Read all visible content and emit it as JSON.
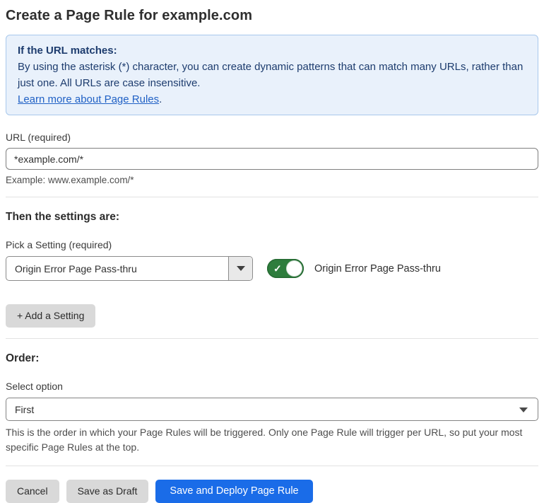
{
  "page": {
    "title": "Create a Page Rule for example.com"
  },
  "info_box": {
    "heading": "If the URL matches:",
    "body": "By using the asterisk (*) character, you can create dynamic patterns that can match many URLs, rather than just one. All URLs are case insensitive.",
    "link_label": "Learn more about Page Rules",
    "link_suffix": "."
  },
  "url_field": {
    "label": "URL (required)",
    "value": "*example.com/*",
    "example": "Example: www.example.com/*"
  },
  "settings_section": {
    "heading": "Then the settings are:",
    "picker_label": "Pick a Setting (required)",
    "selected_setting": "Origin Error Page Pass-thru",
    "toggle_label": "Origin Error Page Pass-thru",
    "toggle_state": "on",
    "toggle_check_glyph": "✓",
    "add_setting_label": "+ Add a Setting"
  },
  "order_section": {
    "heading": "Order:",
    "select_label": "Select option",
    "selected_option": "First",
    "help_text": "This is the order in which your Page Rules will be triggered. Only one Page Rule will trigger per URL, so put your most specific Page Rules at the top."
  },
  "footer": {
    "cancel_label": "Cancel",
    "save_draft_label": "Save as Draft",
    "save_deploy_label": "Save and Deploy Page Rule"
  },
  "colors": {
    "accent_blue": "#1a6ce8",
    "toggle_green": "#2e7d3d",
    "info_box_bg": "#e9f1fb",
    "info_box_border": "#a8c8ec",
    "info_text": "#1d3c6e",
    "link_blue": "#2061c5",
    "button_gray": "#d9d9d9"
  },
  "icons": {
    "dropdown_caret": "caret-down-icon",
    "select_caret": "caret-down-icon",
    "toggle_check": "check-icon"
  }
}
